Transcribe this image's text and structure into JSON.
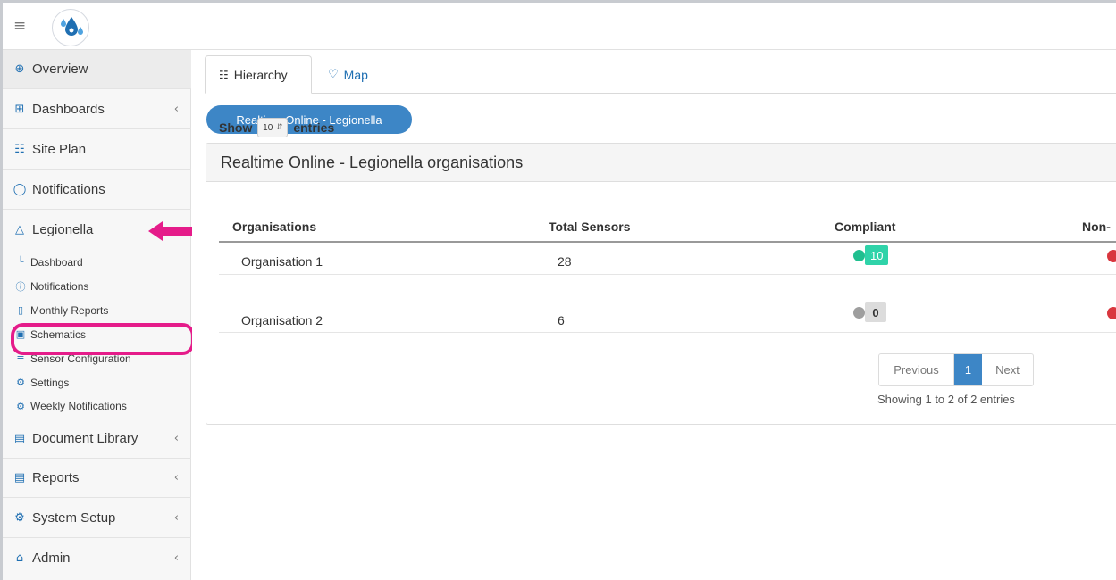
{
  "topbar": {
    "menu_icon": "hamburger-icon",
    "logo_icon": "water-drops-logo"
  },
  "sidebar": {
    "items": [
      {
        "label": "Overview",
        "icon": "globe-icon",
        "glyph": "⊕"
      },
      {
        "label": "Dashboards",
        "icon": "grid-icon",
        "glyph": "⊞",
        "chevron": "‹"
      },
      {
        "label": "Site Plan",
        "icon": "hierarchy-icon",
        "glyph": "☷"
      },
      {
        "label": "Notifications",
        "icon": "speech-bubble-icon",
        "glyph": "◯"
      },
      {
        "label": "Legionella",
        "icon": "droplet-icon",
        "glyph": "△"
      },
      {
        "label": "Document Library",
        "icon": "document-icon",
        "glyph": "▤",
        "chevron": "‹"
      },
      {
        "label": "Reports",
        "icon": "document-icon",
        "glyph": "▤",
        "chevron": "‹"
      },
      {
        "label": "System Setup",
        "icon": "cogs-icon",
        "glyph": "⚙",
        "chevron": "‹"
      },
      {
        "label": "Admin",
        "icon": "lock-icon",
        "glyph": "⌂",
        "chevron": "‹"
      }
    ],
    "subitems": [
      {
        "label": "Dashboard",
        "icon": "line-chart-icon",
        "glyph": "└"
      },
      {
        "label": "Notifications",
        "icon": "info-circle-icon",
        "glyph": "ⓘ"
      },
      {
        "label": "Monthly Reports",
        "icon": "file-icon",
        "glyph": "▯"
      },
      {
        "label": "Schematics",
        "icon": "schematic-icon",
        "glyph": "▣"
      },
      {
        "label": "Sensor Configuration",
        "icon": "sliders-icon",
        "glyph": "≡"
      },
      {
        "label": "Settings",
        "icon": "gear-icon",
        "glyph": "⚙"
      },
      {
        "label": "Weekly Notifications",
        "icon": "cogs-icon",
        "glyph": "⚙"
      }
    ]
  },
  "tabs": [
    {
      "label": "Hierarchy",
      "icon": "hierarchy-icon",
      "glyph": "☷"
    },
    {
      "label": "Map",
      "icon": "map-pin-icon",
      "glyph": "♡"
    }
  ],
  "breadcrumb": {
    "label": "Realtime Online - Legionella"
  },
  "panel": {
    "title": "Realtime Online - Legionella organisations",
    "show_label": "Show",
    "show_value": "10",
    "entries_label": "entries",
    "columns": [
      "Organisations",
      "Total Sensors",
      "Compliant",
      "Non-"
    ],
    "rows": [
      {
        "organisation": "Organisation 1",
        "total_sensors": "28",
        "compliant": "10",
        "compliant_status": "green"
      },
      {
        "organisation": "Organisation 2",
        "total_sensors": "6",
        "compliant": "0",
        "compliant_status": "grey"
      }
    ],
    "pagination": {
      "previous": "Previous",
      "current": "1",
      "next": "Next"
    },
    "showing": "Showing 1 to 2 of 2 entries"
  },
  "colors": {
    "accent": "#3d86c6",
    "annotation_pink": "#e51c8a",
    "compliant_green": "#2fd3a9",
    "status_red": "#d9363e"
  }
}
